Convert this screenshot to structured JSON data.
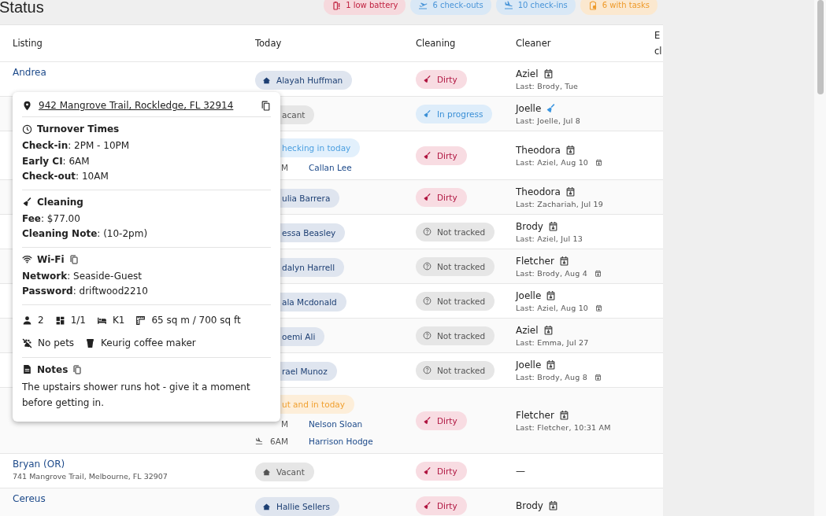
{
  "title": "Status",
  "badges": [
    {
      "kind": "battery",
      "label": "1 low battery"
    },
    {
      "kind": "departure",
      "label": "6 check-outs"
    },
    {
      "kind": "arrival",
      "label": "10 check-ins"
    },
    {
      "kind": "tasks",
      "label": "6 with tasks"
    }
  ],
  "table": {
    "columns": [
      "Listing",
      "Today",
      "Cleaning",
      "Cleaner"
    ],
    "column_5": {
      "lines": [
        "E",
        "cl"
      ]
    },
    "rows": [
      {
        "listing": {
          "name": "Andrea"
        },
        "today": {
          "chip": {
            "kind": "guest",
            "label": "Alayah Huffman",
            "covered": false
          }
        },
        "cleaning": {
          "kind": "dirty",
          "label": "Dirty"
        },
        "cleaner": {
          "name": "Aziel",
          "kind": "scheduled",
          "last": "Last: Brody, Tue",
          "calendar": false
        }
      },
      {
        "today": {
          "chip": {
            "kind": "vacant",
            "label": "acant",
            "covered": true
          }
        },
        "cleaning": {
          "kind": "in_progress",
          "label": "In progress"
        },
        "cleaner": {
          "name": "Joelle",
          "kind": "cleaning",
          "last": "Last: Joelle, Jul 8",
          "calendar": false
        }
      },
      {
        "today": {
          "chip": {
            "kind": "checkin",
            "label": "hecking in today",
            "covered": true
          },
          "guests": [
            {
              "time": "M",
              "name": "Callan Lee"
            }
          ]
        },
        "cleaning": {
          "kind": "dirty",
          "label": "Dirty"
        },
        "cleaner": {
          "name": "Theodora",
          "kind": "scheduled",
          "last": "Last: Aziel, Aug 10",
          "calendar": true
        }
      },
      {
        "today": {
          "chip": {
            "kind": "guest",
            "label": "ulia Barrera",
            "covered": true
          }
        },
        "cleaning": {
          "kind": "dirty",
          "label": "Dirty"
        },
        "cleaner": {
          "name": "Theodora",
          "kind": "scheduled",
          "last": "Last: Zachariah, Jul 19",
          "calendar": false
        }
      },
      {
        "today": {
          "chip": {
            "kind": "guest",
            "label": "essa Beasley",
            "covered": true
          }
        },
        "cleaning": {
          "kind": "not_tracked",
          "label": "Not tracked"
        },
        "cleaner": {
          "name": "Brody",
          "kind": "scheduled",
          "last": "Last: Aziel, Jul 13",
          "calendar": false
        }
      },
      {
        "today": {
          "chip": {
            "kind": "guest",
            "label": "dalyn Harrell",
            "covered": true
          }
        },
        "cleaning": {
          "kind": "not_tracked",
          "label": "Not tracked"
        },
        "cleaner": {
          "name": "Fletcher",
          "kind": "scheduled",
          "last": "Last: Brody, Aug 4",
          "calendar": true
        }
      },
      {
        "today": {
          "chip": {
            "kind": "guest",
            "label": "ala Mcdonald",
            "covered": true
          }
        },
        "cleaning": {
          "kind": "not_tracked",
          "label": "Not tracked"
        },
        "cleaner": {
          "name": "Joelle",
          "kind": "scheduled",
          "last": "Last: Aziel, Aug 10",
          "calendar": true
        }
      },
      {
        "today": {
          "chip": {
            "kind": "guest",
            "label": "oemi Ali",
            "covered": true
          }
        },
        "cleaning": {
          "kind": "not_tracked",
          "label": "Not tracked"
        },
        "cleaner": {
          "name": "Aziel",
          "kind": "scheduled",
          "last": "Last: Emma, Jul 27",
          "calendar": false
        }
      },
      {
        "today": {
          "chip": {
            "kind": "guest",
            "label": "rael Munoz",
            "covered": true
          }
        },
        "cleaning": {
          "kind": "not_tracked",
          "label": "Not tracked"
        },
        "cleaner": {
          "name": "Joelle",
          "kind": "scheduled",
          "last": "Last: Brody, Aug 8",
          "calendar": true
        }
      },
      {
        "today": {
          "chip": {
            "kind": "turnover",
            "label": "ut and in today",
            "covered": true
          },
          "guests": [
            {
              "time": "M",
              "name": "Nelson Sloan"
            },
            {
              "kind": "arrival",
              "time": "6AM",
              "name": "Harrison Hodge"
            }
          ]
        },
        "cleaning": {
          "kind": "dirty",
          "label": "Dirty"
        },
        "cleaner": {
          "name": "Fletcher",
          "kind": "scheduled",
          "last": "Last: Fletcher, 10:31 AM",
          "calendar": false
        }
      },
      {
        "listing": {
          "name": "Bryan (OR)",
          "address": "741 Mangrove Trail, Melbourne, FL 32907"
        },
        "today": {
          "chip": {
            "kind": "vacant",
            "label": "Vacant",
            "covered": false
          }
        },
        "cleaning": {
          "kind": "dirty",
          "label": "Dirty"
        },
        "cleaner": {
          "empty": "—"
        }
      },
      {
        "listing": {
          "name": "Cereus"
        },
        "today": {
          "chip": {
            "kind": "guest",
            "label": "Hallie Sellers",
            "covered": false
          }
        },
        "cleaning": {
          "kind": "dirty",
          "label": "Dirty"
        },
        "cleaner": {
          "name": "Brody",
          "kind": "scheduled"
        }
      }
    ]
  },
  "popover": {
    "address": "942 Mangrove Trail, Rockledge, FL 32914",
    "sections": [
      {
        "kind": "times",
        "title": "Turnover Times",
        "copy": false,
        "lines": [
          "**Check-in**: 2PM - 10PM",
          "**Early CI**: 6AM",
          "**Check-out**: 10AM"
        ]
      },
      {
        "kind": "cleaning",
        "title": "Cleaning",
        "copy": false,
        "lines": [
          "**Fee**: $77.00",
          "**Cleaning Note**: (10-2pm)"
        ]
      },
      {
        "kind": "wifi",
        "title": "Wi-Fi",
        "copy": true,
        "lines": [
          "**Network**: Seaside-Guest",
          "**Password**: driftwood2210"
        ]
      },
      {
        "kind": "facts",
        "items": [
          {
            "kind": "guests",
            "text": "2"
          },
          {
            "kind": "rooms",
            "text": "1/1"
          },
          {
            "kind": "beds",
            "text": "K1"
          },
          {
            "kind": "area",
            "text": "65 sq m / 700 sq ft"
          }
        ]
      },
      {
        "kind": "facts",
        "items": [
          {
            "kind": "pets",
            "text": "No pets"
          },
          {
            "kind": "coffee",
            "text": "Keurig coffee maker"
          }
        ]
      },
      {
        "kind": "note",
        "title": "Notes",
        "copy": true,
        "text": "The upstairs shower runs hot - give it a moment before getting in."
      }
    ]
  }
}
